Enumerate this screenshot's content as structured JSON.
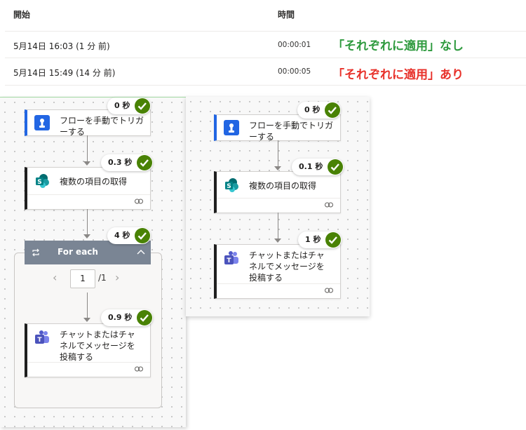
{
  "table": {
    "headers": {
      "start": "開始",
      "duration": "時間"
    },
    "rows": [
      {
        "start": "5月14日 16:03 (1 分 前)",
        "duration": "00:00:01",
        "note": "「それぞれに適用」なし",
        "note_color": "#2e9a3e"
      },
      {
        "start": "5月14日 15:49 (14 分 前)",
        "duration": "00:00:05",
        "note": "「それぞれに適用」あり",
        "note_color": "#e8322b"
      }
    ]
  },
  "left_flow": {
    "steps": [
      {
        "title": "フローを手動でトリガーする",
        "time": "0 秒",
        "icon": "manual-trigger-icon"
      },
      {
        "title": "複数の項目の取得",
        "time": "0.3 秒",
        "icon": "sharepoint-icon"
      },
      {
        "title": "For each",
        "time": "4 秒",
        "icon": "loop-icon"
      },
      {
        "title": "チャットまたはチャネルでメッセージを投稿する",
        "time": "0.9 秒",
        "icon": "teams-icon"
      }
    ],
    "pager": {
      "current": "1",
      "total": "/1"
    }
  },
  "right_flow": {
    "steps": [
      {
        "title": "フローを手動でトリガーする",
        "time": "0 秒",
        "icon": "manual-trigger-icon"
      },
      {
        "title": "複数の項目の取得",
        "time": "0.1 秒",
        "icon": "sharepoint-icon"
      },
      {
        "title": "チャットまたはチャネルでメッセージを投稿する",
        "time": "1 秒",
        "icon": "teams-icon"
      }
    ]
  },
  "colors": {
    "success": "#498205",
    "trigger_accent": "#2266e3",
    "sharepoint": "#038387",
    "teams": "#5059c9"
  }
}
